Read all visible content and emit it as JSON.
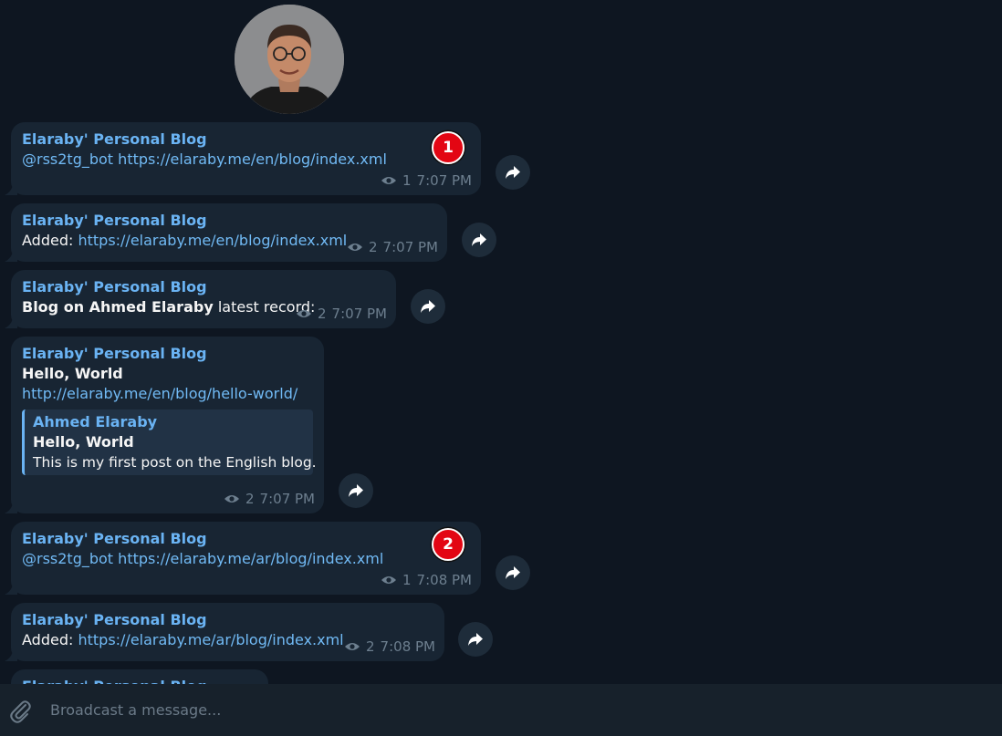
{
  "messages": [
    {
      "author": "Elaraby' Personal Blog",
      "mention": "@rss2tg_bot",
      "link": "https://elaraby.me/en/blog/index.xml",
      "views": "1",
      "time": "7:07 PM",
      "badge": "1"
    },
    {
      "author": "Elaraby' Personal Blog",
      "prefix": "Added:",
      "link": "https://elaraby.me/en/blog/index.xml",
      "views": "2",
      "time": "7:07 PM"
    },
    {
      "author": "Elaraby' Personal Blog",
      "bold": "Blog on Ahmed Elaraby",
      "suffix": "latest record:",
      "views": "2",
      "time": "7:07 PM"
    },
    {
      "author": "Elaraby' Personal Blog",
      "bold": "Hello, World",
      "link": "http://elaraby.me/en/blog/hello-world/",
      "preview": {
        "site": "Ahmed Elaraby",
        "title": "Hello, World",
        "description": "This is my first post on the English blog."
      },
      "views": "2",
      "time": "7:07 PM"
    },
    {
      "author": "Elaraby' Personal Blog",
      "mention": "@rss2tg_bot",
      "link": "https://elaraby.me/ar/blog/index.xml",
      "views": "1",
      "time": "7:08 PM",
      "badge": "2"
    },
    {
      "author": "Elaraby' Personal Blog",
      "prefix": "Added:",
      "link": "https://elaraby.me/ar/blog/index.xml",
      "views": "2",
      "time": "7:08 PM"
    },
    {
      "author": "Elaraby' Personal Blog"
    }
  ],
  "composer": {
    "placeholder": "Broadcast a message..."
  },
  "icons": {
    "avatar": "channel-avatar",
    "views": "eye-icon",
    "forward": "share-arrow-icon",
    "attach": "paperclip-icon"
  },
  "colors": {
    "background": "#0e1621",
    "bubble": "#182533",
    "accent": "#6ab3f3",
    "badge": "#e30613"
  }
}
